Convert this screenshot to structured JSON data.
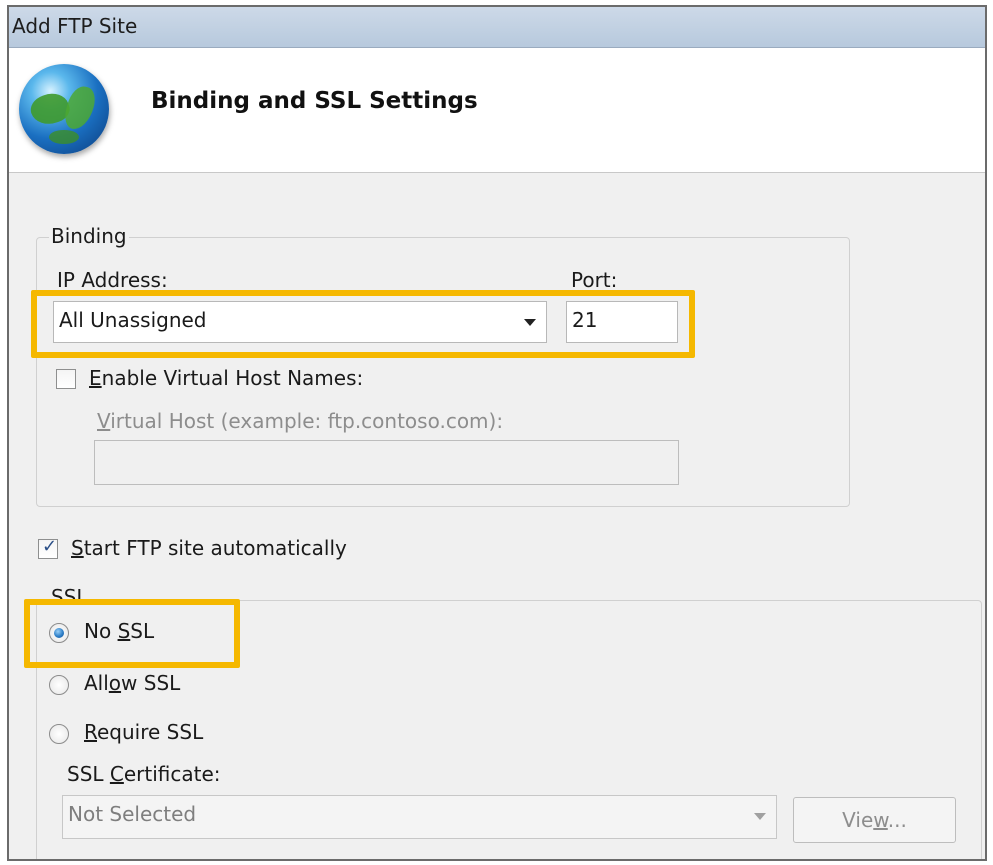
{
  "window": {
    "title": "Add FTP Site"
  },
  "header": {
    "heading": "Binding and SSL Settings",
    "icon": "globe-icon"
  },
  "binding": {
    "group_label": "Binding",
    "ip_label": "IP Address:",
    "ip_value": "All Unassigned",
    "port_label": "Port:",
    "port_value": "21",
    "enable_virtual_host_label": "Enable Virtual Host Names:",
    "enable_virtual_host_checked": false,
    "virtual_host_label": "Virtual Host (example: ftp.contoso.com):",
    "virtual_host_value": ""
  },
  "start_automatically": {
    "label": "Start FTP site automatically",
    "checked": true
  },
  "ssl": {
    "group_label": "SSL",
    "options": [
      {
        "label": "No SSL",
        "selected": true
      },
      {
        "label": "Allow SSL",
        "selected": false
      },
      {
        "label": "Require SSL",
        "selected": false
      }
    ],
    "certificate_label": "SSL Certificate:",
    "certificate_value": "Not Selected",
    "view_button": "View..."
  },
  "colors": {
    "highlight": "#f5b800",
    "titlebar": "#c2d3e6"
  }
}
